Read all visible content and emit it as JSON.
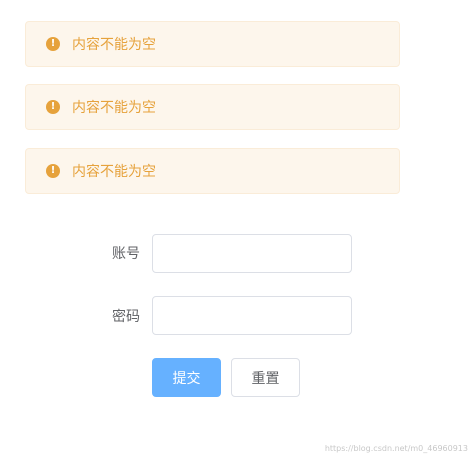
{
  "alerts": [
    {
      "type": "warning",
      "icon": "exclamation-circle-icon",
      "icon_glyph": "!",
      "text": "内容不能为空"
    },
    {
      "type": "warning",
      "icon": "exclamation-circle-icon",
      "icon_glyph": "!",
      "text": "内容不能为空"
    },
    {
      "type": "warning",
      "icon": "exclamation-circle-icon",
      "icon_glyph": "!",
      "text": "内容不能为空"
    }
  ],
  "colors": {
    "warning": "#e6a23c",
    "warning_bg": "#fdf6ec",
    "primary_light": "#66b1ff",
    "border": "#dcdfe6",
    "text_regular": "#606266"
  },
  "form": {
    "account_label": "账号",
    "account_value": "",
    "password_label": "密码",
    "password_value": "",
    "submit_label": "提交",
    "reset_label": "重置"
  },
  "watermark": "https://blog.csdn.net/m0_46960913"
}
